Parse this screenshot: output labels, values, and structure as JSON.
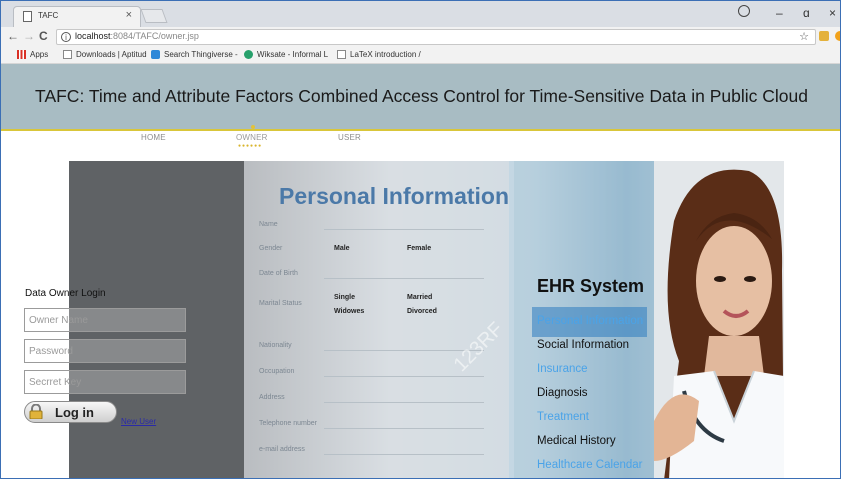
{
  "browser": {
    "tab_title": "TAFC",
    "tab_close": "×",
    "window_controls": {
      "minimize": "–",
      "maximize": "ɑ",
      "close": "×"
    },
    "nav": {
      "back": "←",
      "forward": "→",
      "reload": "C"
    },
    "url_host": "localhost",
    "url_rest": ":8084/TAFC/owner.jsp",
    "star": "☆",
    "bookmarks": [
      {
        "label": "Apps",
        "icon": "apps-grid-icon",
        "color": "#d93025"
      },
      {
        "label": "Downloads | Aptitud",
        "icon": "page-icon",
        "color": "#888888"
      },
      {
        "label": "Search Thingiverse -",
        "icon": "thingiverse-icon",
        "color": "#2f88d8"
      },
      {
        "label": "Wiksate - Informal L",
        "icon": "wiksate-icon",
        "color": "#27a06b"
      },
      {
        "label": "LaTeX introduction /",
        "icon": "page-icon",
        "color": "#888888"
      }
    ]
  },
  "header": {
    "title": "TAFC: Time and Attribute Factors Combined Access Control for Time-Sensitive Data in Public Cloud",
    "banner_color": "#a8bcc3",
    "accent_color": "#d9c63a"
  },
  "menu": {
    "home": "HOME",
    "owner": "OWNER",
    "user": "USER",
    "active": "OWNER"
  },
  "hero": {
    "title": "Personal Information",
    "fields": [
      "Name",
      "Gender",
      "Date of Birth",
      "Marital Status",
      "Nationality",
      "Occupation",
      "Address",
      "Telephone number",
      "e-mail address"
    ],
    "gender_male": "Male",
    "gender_female": "Female",
    "marital_single": "Single",
    "marital_married": "Married",
    "marital_widowed": "Widowes",
    "marital_divorced": "Divorced",
    "watermark": "123RF",
    "ehr_title": "EHR System",
    "ehr_items": [
      "Personal Information",
      "Social Information",
      "Insurance",
      "Diagnosis",
      "Treatment",
      "Medical History",
      "Healthcare Calendar"
    ]
  },
  "login": {
    "title": "Data Owner Login",
    "owner_name_placeholder": "Owner Name",
    "password_placeholder": "Password",
    "secret_key_placeholder": "Secrret Key",
    "button": "Log in",
    "new_user": "New User"
  }
}
